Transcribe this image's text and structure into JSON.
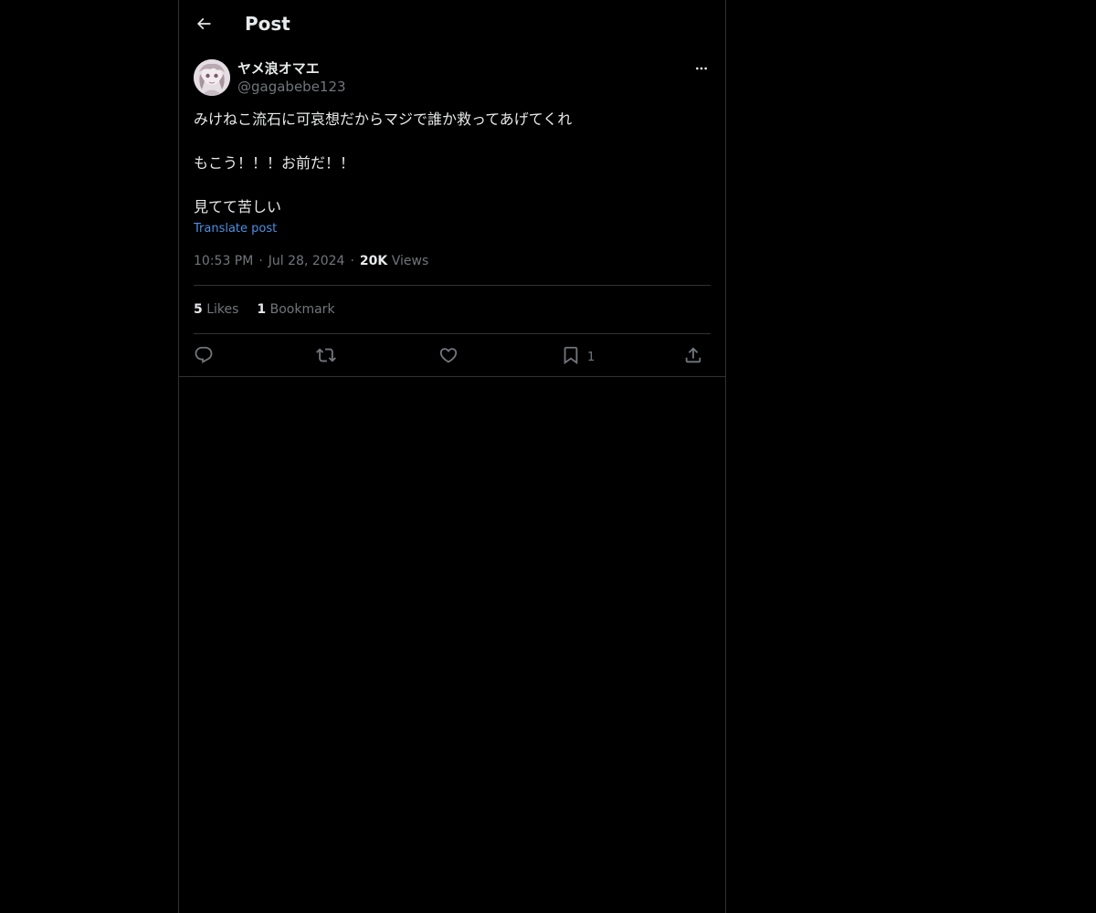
{
  "header": {
    "title": "Post",
    "back_icon": "arrow-left-icon"
  },
  "author": {
    "display_name": "ヤメ浪オマエ",
    "handle": "@gagabebe123",
    "avatar_icon": "avatar-image"
  },
  "post": {
    "lines": [
      "みけねこ流石に可哀想だからマジで誰か救ってあげてくれ",
      "もこう！！！お前だ！！",
      "見てて苦しい"
    ],
    "translate_label": "Translate post"
  },
  "meta": {
    "time": "10:53 PM",
    "date": "Jul 28, 2024",
    "views_count": "20K",
    "views_label": "Views"
  },
  "stats": {
    "likes_count": "5",
    "likes_label": "Likes",
    "bookmarks_count": "1",
    "bookmarks_label": "Bookmark"
  },
  "actions": {
    "reply_icon": "reply-icon",
    "repost_icon": "repost-icon",
    "like_icon": "like-icon",
    "bookmark_icon": "bookmark-icon",
    "bookmark_count": "1",
    "share_icon": "share-icon"
  },
  "colors": {
    "background": "#000000",
    "border": "#2f3336",
    "text_primary": "#e7e9ea",
    "text_secondary": "#71767b",
    "link": "#4e8fe0"
  }
}
